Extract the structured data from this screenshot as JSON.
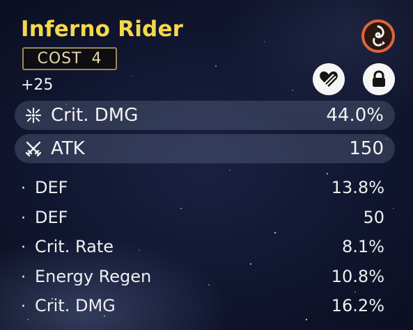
{
  "echo": {
    "name": "Inferno Rider",
    "cost_label": "COST",
    "cost_value": "4",
    "level": "+25"
  },
  "icons": {
    "sonata": "sonata-set-icon",
    "discard": "heart-broken-icon",
    "lock": "lock-icon",
    "crit_dmg": "crit-dmg-icon",
    "atk": "atk-swords-icon"
  },
  "colors": {
    "title": "#f5d84a",
    "sonata_ring": "#e0653a",
    "badge_border": "#9a8c5a"
  },
  "main_stats": [
    {
      "name": "Crit. DMG",
      "value": "44.0%"
    },
    {
      "name": "ATK",
      "value": "150"
    }
  ],
  "sub_stats": [
    {
      "bullet": "·",
      "name": "DEF",
      "value": "13.8%"
    },
    {
      "bullet": "·",
      "name": "DEF",
      "value": "50"
    },
    {
      "bullet": "·",
      "name": "Crit. Rate",
      "value": "8.1%"
    },
    {
      "bullet": "·",
      "name": "Energy Regen",
      "value": "10.8%"
    },
    {
      "bullet": "·",
      "name": "Crit. DMG",
      "value": "16.2%"
    }
  ]
}
